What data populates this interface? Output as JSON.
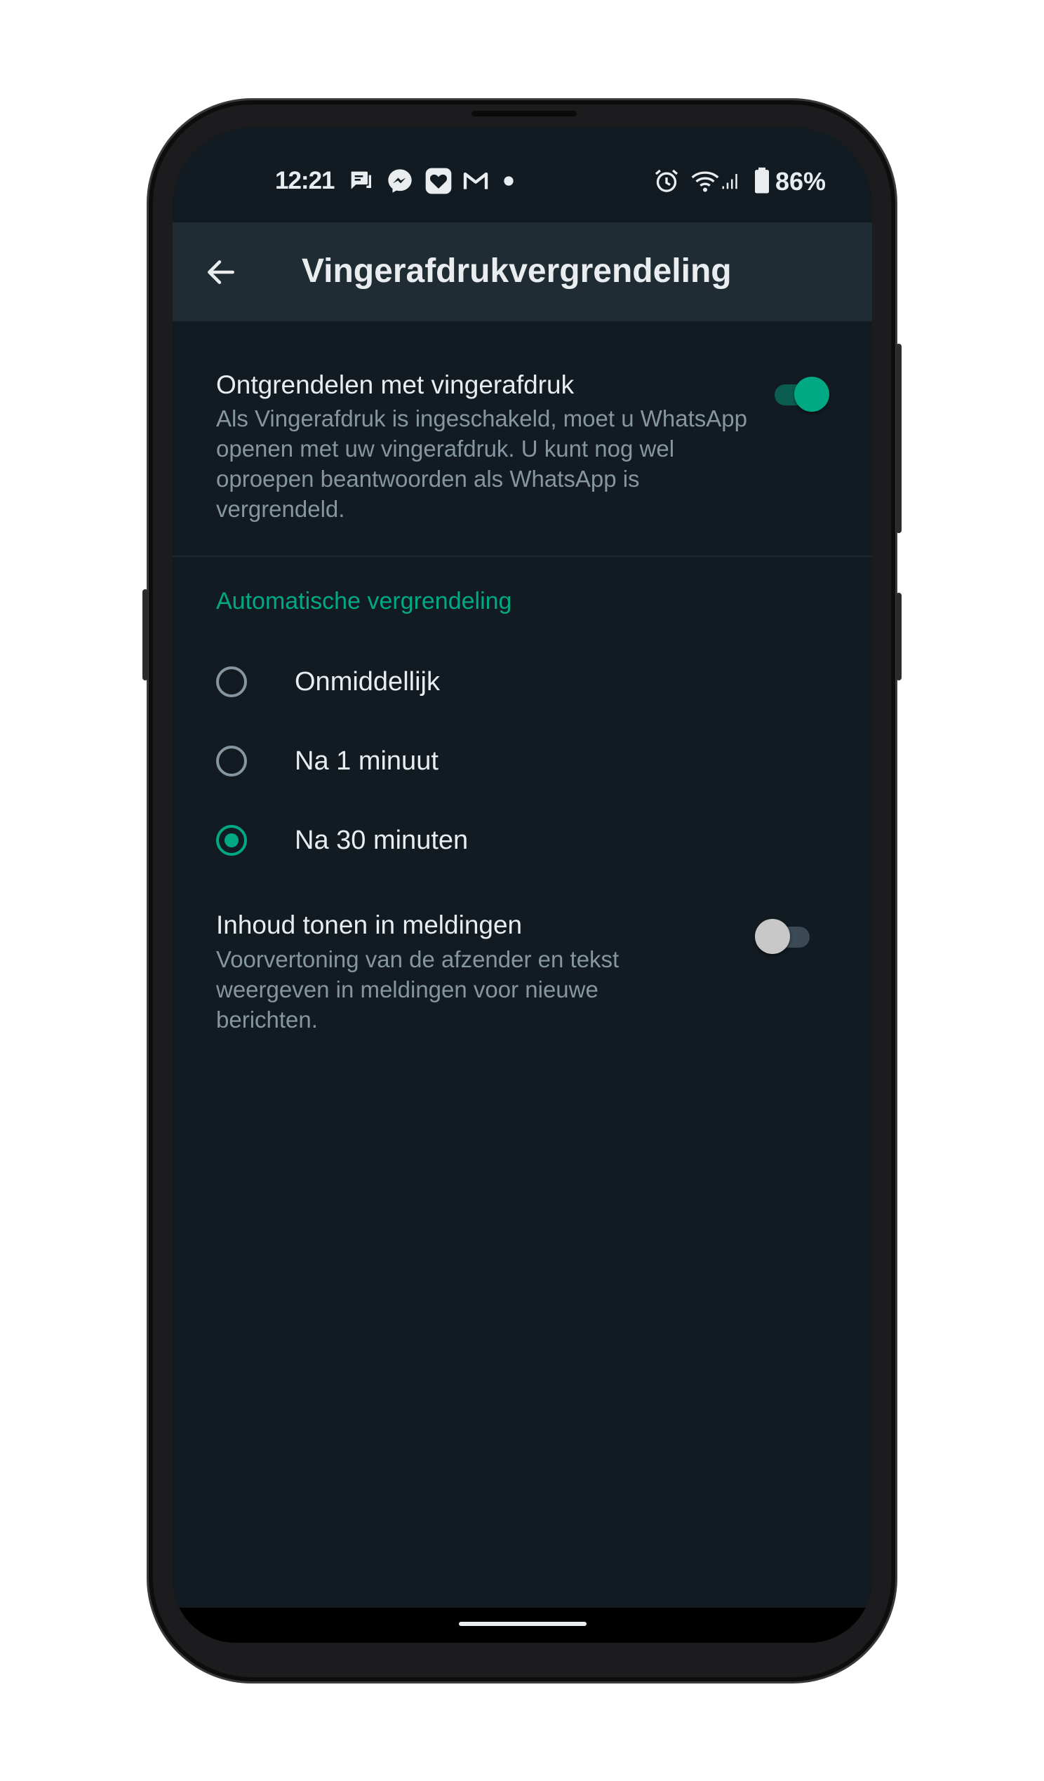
{
  "status_bar": {
    "time": "12:21",
    "battery_percent": "86%",
    "left_icons": [
      "chat-notification-icon",
      "messenger-icon",
      "heart-app-icon",
      "gmail-icon",
      "more-dot-icon"
    ],
    "right_icons": [
      "alarm-icon",
      "wifi-icon",
      "cellular-signal-icon",
      "battery-icon"
    ]
  },
  "app_bar": {
    "back_icon": "arrow-left-icon",
    "title": "Vingerafdrukvergrendeling"
  },
  "fingerprint_setting": {
    "title": "Ontgrendelen met vingerafdruk",
    "description": "Als Vingerafdruk is ingeschakeld, moet u WhatsApp openen met uw vingerafdruk. U kunt nog wel oproepen beantwoorden als WhatsApp is vergrendeld.",
    "enabled": true
  },
  "auto_lock": {
    "header": "Automatische vergrendeling",
    "options": [
      {
        "label": "Onmiddellijk",
        "selected": false
      },
      {
        "label": "Na 1 minuut",
        "selected": false
      },
      {
        "label": "Na 30 minuten",
        "selected": true
      }
    ]
  },
  "notification_setting": {
    "title": "Inhoud tonen in meldingen",
    "description": "Voorvertoning van de afzender en tekst weergeven in meldingen voor nieuwe berichten.",
    "enabled": false
  },
  "colors": {
    "accent": "#00a884",
    "background": "#111b21",
    "app_bar": "#202c33",
    "primary_text": "#e9edef",
    "secondary_text": "#8696a0"
  }
}
